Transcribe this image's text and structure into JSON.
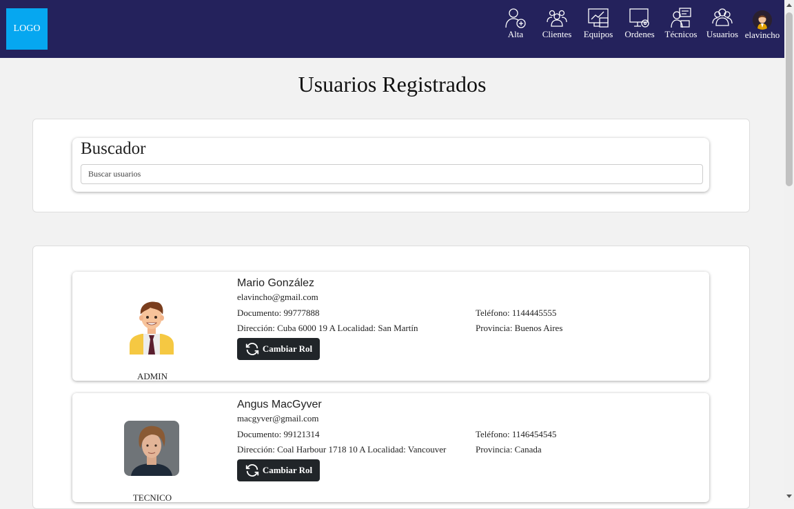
{
  "nav": {
    "logo": "LOGO",
    "items": [
      {
        "label": "Alta",
        "icon": "user-plus-icon"
      },
      {
        "label": "Clientes",
        "icon": "clients-group-icon"
      },
      {
        "label": "Equipos",
        "icon": "equipment-icon"
      },
      {
        "label": "Ordenes",
        "icon": "orders-icon"
      },
      {
        "label": "Técnicos",
        "icon": "technicians-icon"
      },
      {
        "label": "Usuarios",
        "icon": "users-icon"
      }
    ],
    "user": "elavincho"
  },
  "page": {
    "title": "Usuarios Registrados"
  },
  "search": {
    "title": "Buscador",
    "placeholder": "Buscar usuarios"
  },
  "users": [
    {
      "name": "Mario González",
      "email": "elavincho@gmail.com",
      "documento": "Documento: 99777888",
      "telefono": "Teléfono: 1144445555",
      "direccion": "Dirección: Cuba 6000 19 A Localidad: San Martín",
      "provincia": "Provincia: Buenos Aires",
      "role": "ADMIN",
      "button": "Cambiar Rol"
    },
    {
      "name": "Angus MacGyver",
      "email": "macgyver@gmail.com",
      "documento": "Documento: 99121314",
      "telefono": "Teléfono: 1146454545",
      "direccion": "Dirección: Coal Harbour 1718 10 A Localidad: Vancouver",
      "provincia": "Provincia: Canada",
      "role": "TECNICO",
      "button": "Cambiar Rol"
    }
  ],
  "colors": {
    "navbar": "#24225c",
    "logo": "#06a7f0",
    "button": "#212529"
  }
}
